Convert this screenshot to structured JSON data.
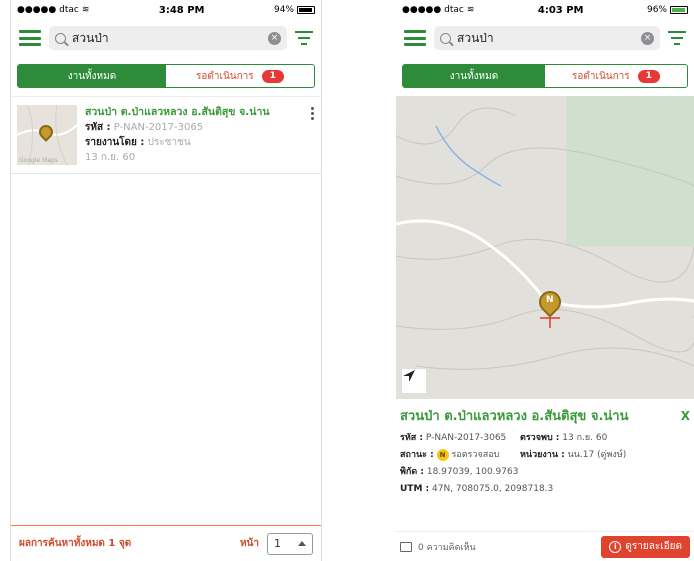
{
  "left": {
    "status": {
      "carrier": "●●●●● dtac",
      "time": "3:48 PM",
      "battery": "94%",
      "battery_level": 0.94
    },
    "search": {
      "value": "สวนป่า"
    },
    "tabs": {
      "all": "งานทั้งหมด",
      "pending": "รอดำเนินการ",
      "pending_count": "1"
    },
    "item": {
      "title": "สวนป่า ต.ป่าแลวหลวง อ.สันติสุข จ.น่าน",
      "code_label": "รหัส :",
      "code": "P-NAN-2017-3065",
      "reporter_label": "รายงานโดย :",
      "reporter": "ประชาชน",
      "date": "13 ก.ย. 60",
      "thumb_credit": "Google Maps"
    },
    "footer": {
      "results": "ผลการค้นหาทั้งหมด 1 จุด",
      "page_label": "หน้า",
      "page": "1"
    }
  },
  "right": {
    "status": {
      "carrier": "●●●●● dtac",
      "time": "4:03 PM",
      "battery": "96%",
      "battery_level": 0.96
    },
    "search": {
      "value": "สวนป่า"
    },
    "tabs": {
      "all": "งานทั้งหมด",
      "pending": "รอดำเนินการ",
      "pending_count": "1"
    },
    "map": {
      "pin_letter": "N"
    },
    "detail": {
      "title": "สวนป่า ต.ป่าแลวหลวง อ.สันติสุข จ.น่าน",
      "close": "X",
      "code_label": "รหัส :",
      "code": "P-NAN-2017-3065",
      "inspect_label": "ตรวจพบ :",
      "inspect_date": "13 ก.ย. 60",
      "status_label": "สถานะ :",
      "status_letter": "N",
      "status": "รอตรวจสอบ",
      "unit_label": "หน่วยงาน :",
      "unit": "นน.17 (ดู่พงษ์)",
      "coords_label": "พิกัด :",
      "coords": "18.97039, 100.9763",
      "utm_label": "UTM :",
      "utm": "47N, 708075.0, 2098718.3"
    },
    "footer": {
      "comments": "0 ความคิดเห็น",
      "details_button": "ดูรายละเอียด"
    }
  }
}
